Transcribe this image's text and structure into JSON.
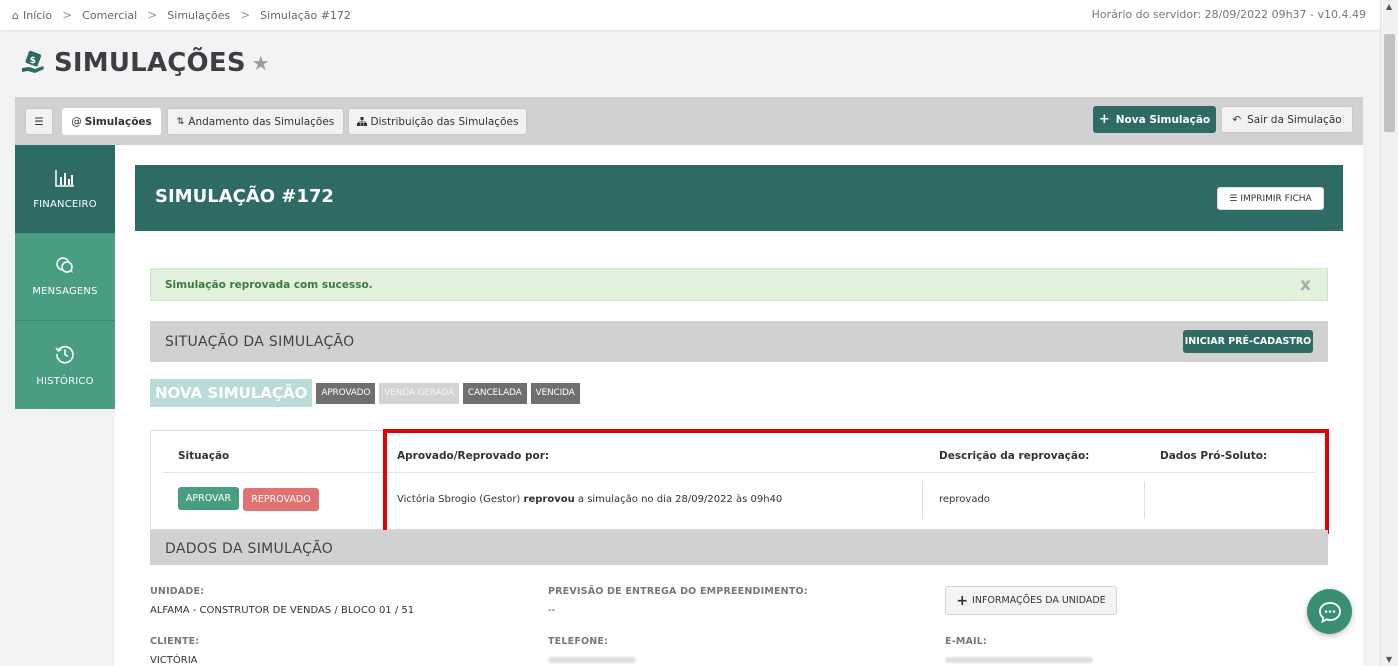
{
  "breadcrumb": {
    "items": [
      "Início",
      "Comercial",
      "Simulações",
      "Simulação #172"
    ],
    "home_icon": "home-icon",
    "separator": ">"
  },
  "server_time": "Horário do servidor: 28/09/2022 09h37 - v10.4.49",
  "page": {
    "title": "SIMULAÇÕES",
    "logo_icon": "money-hand-icon",
    "favorite_icon": "star-icon"
  },
  "toolbar": {
    "menu_icon": "hamburger-icon",
    "tabs": [
      {
        "label": "Simulações",
        "icon": "at-icon",
        "active": true
      },
      {
        "label": "Andamento das Simulações",
        "icon": "sort-icon"
      },
      {
        "label": "Distribuição das Simulações",
        "icon": "sitemap-icon"
      }
    ],
    "new_label": "Nova Simulação",
    "exit_label": "Sair da Simulação"
  },
  "sidebar": {
    "items": [
      {
        "label": "FINANCEIRO",
        "icon": "bar-chart-icon"
      },
      {
        "label": "MENSAGENS",
        "icon": "chat-bubbles-icon"
      },
      {
        "label": "HISTÓRICO",
        "icon": "history-icon"
      }
    ]
  },
  "simulation": {
    "title": "SIMULAÇÃO #172",
    "print_label": "IMPRIMIR FICHA"
  },
  "alert": {
    "message": "Simulação reprovada com sucesso.",
    "close": "x"
  },
  "situacao": {
    "title": "SITUAÇÃO DA SIMULAÇÃO",
    "action_label": "INICIAR PRÉ-CADASTRO",
    "steps": [
      "NOVA SIMULAÇÃO",
      "APROVADO",
      "VENDA GERADA",
      "CANCELADA",
      "VENCIDA"
    ],
    "headers": [
      "Situação",
      "Aprovado/Reprovado por:",
      "Descrição da reprovação:",
      "Dados Pró-Soluto:"
    ],
    "approve_label": "APROVAR",
    "reject_label": "REPROVADO",
    "approver_name": "Victória Sbrogio (Gestor)",
    "approver_action": "reprovou",
    "approver_rest": "a simulação no dia 28/09/2022 às 09h40",
    "rejection_description": "reprovado",
    "pro_soluto": ""
  },
  "dados": {
    "title": "DADOS DA SIMULAÇÃO",
    "unidade_label": "UNIDADE:",
    "unidade_value": "ALFAMA - CONSTRUTOR DE VENDAS / BLOCO 01 / 51",
    "previsao_label": "PREVISÃO DE ENTREGA DO EMPREENDIMENTO:",
    "previsao_value": "--",
    "info_button": "INFORMAÇÕES DA UNIDADE",
    "cliente_label": "CLIENTE:",
    "cliente_value": "VICTÓRIA",
    "telefone_label": "TELEFONE:",
    "email_label": "E-MAIL:"
  },
  "colors": {
    "primary": "#2e6b65",
    "secondary": "#4a9e80",
    "danger": "#e07272",
    "highlight": "#e30000"
  },
  "chat_icon": "chat-icon"
}
